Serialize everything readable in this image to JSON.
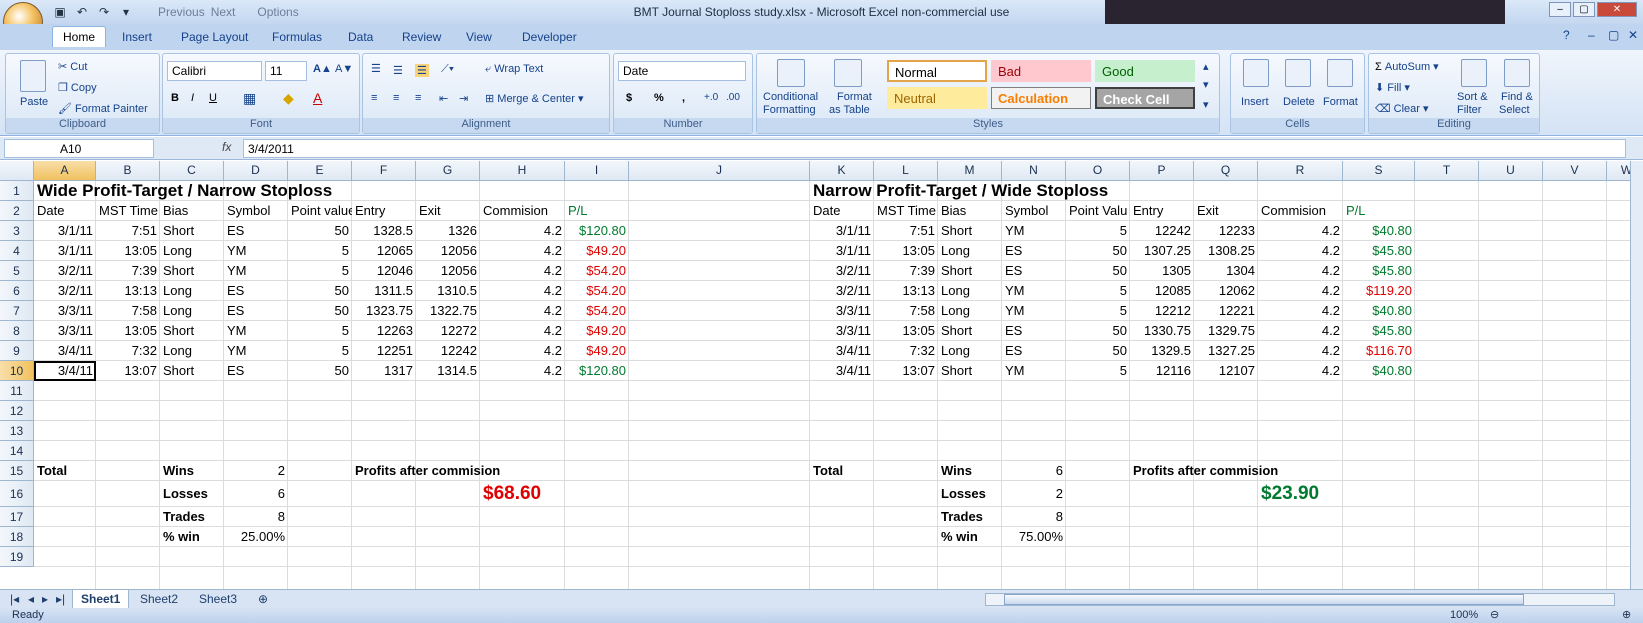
{
  "window": {
    "title": "BMT Journal Stoploss study.xlsx - Microsoft Excel non-commercial use",
    "qat_previous": "Previous",
    "qat_next": "Next",
    "qat_options": "Options"
  },
  "tabs": [
    "Home",
    "Insert",
    "Page Layout",
    "Formulas",
    "Data",
    "Review",
    "View",
    "Developer"
  ],
  "ribbon": {
    "clipboard": {
      "label": "Clipboard",
      "paste": "Paste",
      "cut": "Cut",
      "copy": "Copy",
      "format_painter": "Format Painter"
    },
    "font": {
      "label": "Font",
      "family": "Calibri",
      "size": "11"
    },
    "alignment": {
      "label": "Alignment",
      "wrap": "Wrap Text",
      "merge": "Merge & Center"
    },
    "number": {
      "label": "Number",
      "format": "Date",
      "currency": "$",
      "percent": "%",
      "comma": ","
    },
    "styles": {
      "label": "Styles",
      "cond_fmt_1": "Conditional",
      "cond_fmt_2": "Formatting",
      "fmt_table_1": "Format",
      "fmt_table_2": "as Table",
      "normal": "Normal",
      "bad": "Bad",
      "good": "Good",
      "neutral": "Neutral",
      "calculation": "Calculation",
      "check_cell": "Check Cell"
    },
    "cells": {
      "label": "Cells",
      "insert": "Insert",
      "delete": "Delete",
      "format": "Format"
    },
    "editing": {
      "label": "Editing",
      "autosum": "AutoSum",
      "fill": "Fill",
      "clear": "Clear",
      "sort_1": "Sort &",
      "sort_2": "Filter",
      "find_1": "Find &",
      "find_2": "Select"
    }
  },
  "formula_bar": {
    "name_box": "A10",
    "fx": "fx",
    "value": "3/4/2011"
  },
  "columns": [
    "A",
    "B",
    "C",
    "D",
    "E",
    "F",
    "G",
    "H",
    "I",
    "J",
    "K",
    "L",
    "M",
    "N",
    "O",
    "P",
    "Q",
    "R",
    "S",
    "T",
    "U",
    "V",
    "W"
  ],
  "rows": [
    "1",
    "2",
    "3",
    "4",
    "5",
    "6",
    "7",
    "8",
    "9",
    "10",
    "11",
    "12",
    "13",
    "14",
    "15",
    "16",
    "17",
    "18",
    "19"
  ],
  "left_table": {
    "title": "Wide Profit-Target / Narrow Stoploss",
    "headers": [
      "Date",
      "MST Time",
      "Bias",
      "Symbol",
      "Point value",
      "Entry",
      "Exit",
      "Commision",
      "P/L"
    ],
    "rows": [
      [
        "3/1/11",
        "7:51",
        "Short",
        "ES",
        "50",
        "1328.5",
        "1326",
        "4.2",
        "$120.80"
      ],
      [
        "3/1/11",
        "13:05",
        "Long",
        "YM",
        "5",
        "12065",
        "12056",
        "4.2",
        "$49.20"
      ],
      [
        "3/2/11",
        "7:39",
        "Short",
        "YM",
        "5",
        "12046",
        "12056",
        "4.2",
        "$54.20"
      ],
      [
        "3/2/11",
        "13:13",
        "Long",
        "ES",
        "50",
        "1311.5",
        "1310.5",
        "4.2",
        "$54.20"
      ],
      [
        "3/3/11",
        "7:58",
        "Long",
        "ES",
        "50",
        "1323.75",
        "1322.75",
        "4.2",
        "$54.20"
      ],
      [
        "3/3/11",
        "13:05",
        "Short",
        "YM",
        "5",
        "12263",
        "12272",
        "4.2",
        "$49.20"
      ],
      [
        "3/4/11",
        "7:32",
        "Long",
        "YM",
        "5",
        "12251",
        "12242",
        "4.2",
        "$49.20"
      ],
      [
        "3/4/11",
        "13:07",
        "Short",
        "ES",
        "50",
        "1317",
        "1314.5",
        "4.2",
        "$120.80"
      ]
    ],
    "pl_colors": [
      "green",
      "red",
      "red",
      "red",
      "red",
      "red",
      "red",
      "green"
    ],
    "total": "Total",
    "wins_label": "Wins",
    "wins": "2",
    "losses_label": "Losses",
    "losses": "6",
    "trades_label": "Trades",
    "trades": "8",
    "pctwin_label": "% win",
    "pctwin": "25.00%",
    "profits_label": "Profits after commision",
    "profit": "$68.60"
  },
  "right_table": {
    "title": "Narrow Profit-Target / Wide Stoploss",
    "headers": [
      "Date",
      "MST Time",
      "Bias",
      "Symbol",
      "Point Valu",
      "Entry",
      "Exit",
      "Commision",
      "P/L"
    ],
    "rows": [
      [
        "3/1/11",
        "7:51",
        "Short",
        "YM",
        "5",
        "12242",
        "12233",
        "4.2",
        "$40.80"
      ],
      [
        "3/1/11",
        "13:05",
        "Long",
        "ES",
        "50",
        "1307.25",
        "1308.25",
        "4.2",
        "$45.80"
      ],
      [
        "3/2/11",
        "7:39",
        "Short",
        "ES",
        "50",
        "1305",
        "1304",
        "4.2",
        "$45.80"
      ],
      [
        "3/2/11",
        "13:13",
        "Long",
        "YM",
        "5",
        "12085",
        "12062",
        "4.2",
        "$119.20"
      ],
      [
        "3/3/11",
        "7:58",
        "Long",
        "YM",
        "5",
        "12212",
        "12221",
        "4.2",
        "$40.80"
      ],
      [
        "3/3/11",
        "13:05",
        "Short",
        "ES",
        "50",
        "1330.75",
        "1329.75",
        "4.2",
        "$45.80"
      ],
      [
        "3/4/11",
        "7:32",
        "Long",
        "ES",
        "50",
        "1329.5",
        "1327.25",
        "4.2",
        "$116.70"
      ],
      [
        "3/4/11",
        "13:07",
        "Short",
        "YM",
        "5",
        "12116",
        "12107",
        "4.2",
        "$40.80"
      ]
    ],
    "pl_colors": [
      "green",
      "green",
      "green",
      "red",
      "green",
      "green",
      "red",
      "green"
    ],
    "total": "Total",
    "wins_label": "Wins",
    "wins": "6",
    "losses_label": "Losses",
    "losses": "2",
    "trades_label": "Trades",
    "trades": "8",
    "pctwin_label": "% win",
    "pctwin": "75.00%",
    "profits_label": "Profits after commision",
    "profit": "$23.90"
  },
  "sheets": [
    "Sheet1",
    "Sheet2",
    "Sheet3"
  ],
  "status": {
    "ready": "Ready",
    "zoom": "100%"
  },
  "colors": {
    "green": "#007a2e",
    "red": "#e00000"
  }
}
